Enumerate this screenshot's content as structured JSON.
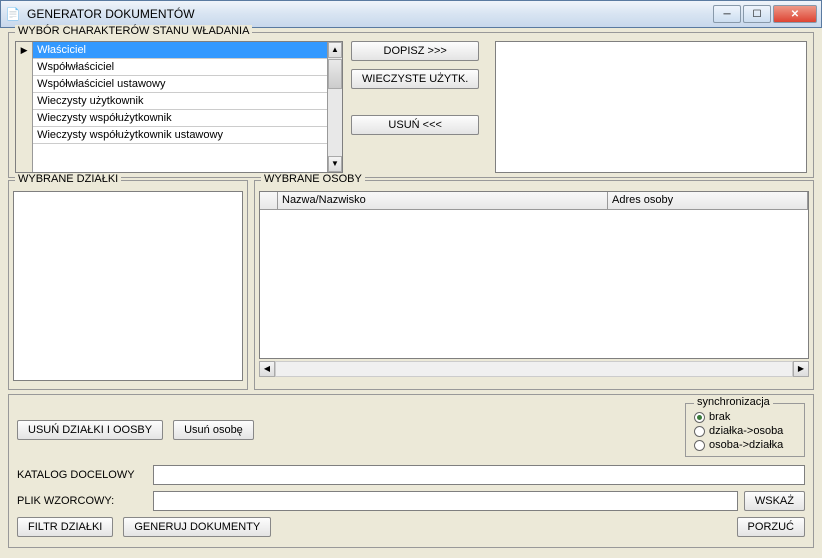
{
  "window": {
    "title": "GENERATOR DOKUMENTÓW"
  },
  "top_group": {
    "title": "WYBÓR CHARAKTERÓW STANU WŁADANIA"
  },
  "char_list": [
    "Właściciel",
    "Współwłaściciel",
    "Współwłaściciel ustawowy",
    "Wieczysty użytkownik",
    "Wieczysty współużytkownik",
    "Wieczysty współużytkownik ustawowy"
  ],
  "buttons": {
    "dopisz": "DOPISZ >>>",
    "wieczyste": "WIECZYSTE UŻYTK.",
    "usun": "USUŃ <<<",
    "usun_dzialki": "USUŃ DZIAŁKI I OOSBY",
    "usun_osobe": "Usuń osobę",
    "wskaz": "WSKAŻ",
    "filtr": "FILTR DZIAŁKI",
    "generuj": "GENERUJ DOKUMENTY",
    "porzuc": "PORZUĆ"
  },
  "dzialki": {
    "title": "WYBRANE DZIAŁKI"
  },
  "osoby": {
    "title": "WYBRANE OSOBY",
    "col1": "Nazwa/Nazwisko",
    "col2": "Adres osoby"
  },
  "sync": {
    "title": "synchronizacja",
    "opt1": "brak",
    "opt2": "działka->osoba",
    "opt3": "osoba->działka"
  },
  "fields": {
    "katalog_label": "KATALOG DOCELOWY",
    "katalog_value": "",
    "plik_label": "PLIK WZORCOWY:",
    "plik_value": ""
  }
}
